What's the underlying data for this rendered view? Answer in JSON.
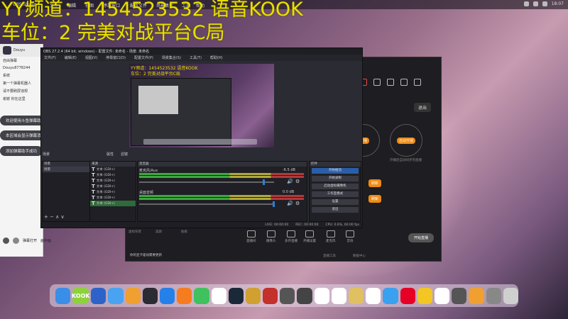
{
  "menubar": {
    "app": "OBS Studio",
    "items": [
      "文件",
      "编辑",
      "视图",
      "停靠窗口",
      "配置文件",
      "场景集合",
      "工具",
      "帮助"
    ],
    "time": "18:07"
  },
  "overlay": {
    "line1": "YY频道：1454523532 语音KOOK",
    "line2": "车位：2 完美对战平台C局"
  },
  "chat": {
    "room": "Douyu",
    "rows": [
      "自由弹幕",
      "Douyu8778244",
      "系统",
      "第一个弹幕机器人",
      "请不要刷屏违规",
      "谢谢 你在这里"
    ],
    "bubbles": [
      "欢迎使用斗鱼弹幕助手",
      "本区域会显示弹幕消息和礼物消息",
      "添加弹幕助手成功"
    ],
    "bottom": [
      "弹幕打开",
      "画中画"
    ]
  },
  "dark_app": {
    "exit_label": "退出",
    "circle_right": "自动开播",
    "circle_left": "开播",
    "caption": "开播后自动同步到直播",
    "orange1": "刷新",
    "orange2": "刷新",
    "controls": [
      "直播间",
      "摄像头",
      "多开直播",
      "开播设置",
      "麦克风",
      "音效"
    ],
    "notice": "你的显卡驱动需要更新",
    "left_tabs": [
      "虚拟背景",
      "美颜",
      "贴纸"
    ],
    "start_label": "开始直播",
    "footer": [
      "直播工具",
      "数据中心"
    ]
  },
  "obs": {
    "title": "OBS 27.2.4 (64 bit, windows) - 配置文件: 未命名 - 场景: 未命名",
    "menu": [
      "文件(F)",
      "编辑(E)",
      "视图(V)",
      "停靠窗口(D)",
      "配置文件(P)",
      "场景集合(S)",
      "工具(T)",
      "帮助(H)"
    ],
    "preview_text1": "YY频道：1454523532 语音KOOK",
    "preview_text2": "车位：2 完美对战平台C局",
    "scene_bar": [
      "场景",
      "属性",
      "滤镜"
    ],
    "panels": {
      "scenes_header": "场景",
      "scenes_item": "场景",
      "sources_header": "来源",
      "mixer_header": "混音器",
      "controls_header": "控件"
    },
    "sources": [
      {
        "name": "文本 (GDI+)",
        "selected": false
      },
      {
        "name": "文本 (GDI+)",
        "selected": false
      },
      {
        "name": "文本 (GDI+)",
        "selected": false
      },
      {
        "name": "文本 (GDI+)",
        "selected": false
      },
      {
        "name": "文本 (GDI+)",
        "selected": false
      },
      {
        "name": "文本 (GDI+)",
        "selected": false
      },
      {
        "name": "文本 (GDI+)",
        "selected": true
      }
    ],
    "mixer": [
      {
        "name": "麦克风/Aux",
        "db": "-6.5 dB"
      },
      {
        "name": "桌面音频",
        "db": "0.0 dB"
      }
    ],
    "controls": [
      "开始推流",
      "开始录制",
      "启动虚拟摄像机",
      "工作室模式",
      "设置",
      "退出"
    ],
    "transition": "转场",
    "status": [
      "LIVE: 00:00:00",
      "REC: 00:00:00",
      "CPU: 0.6%, 60.00 fps"
    ]
  },
  "dock": {
    "apps": [
      {
        "icon": "finder-icon",
        "label": "",
        "color": "#3b8ee8"
      },
      {
        "icon": "kook-icon",
        "label": "KOOK",
        "color": "#8dd13c"
      },
      {
        "icon": "rocket-icon",
        "label": "",
        "color": "#2d63c8"
      },
      {
        "icon": "safari-icon",
        "label": "",
        "color": "#4aa3f0"
      },
      {
        "icon": "orange-app-icon",
        "label": "",
        "color": "#f0a030"
      },
      {
        "icon": "obs-icon",
        "label": "",
        "color": "#2b2b33"
      },
      {
        "icon": "blue-app-icon",
        "label": "",
        "color": "#2680ea"
      },
      {
        "icon": "orange-app-icon",
        "label": "",
        "color": "#f57c1f"
      },
      {
        "icon": "wechat-icon",
        "label": "",
        "color": "#3fc25d"
      },
      {
        "icon": "qq-icon",
        "label": "",
        "color": "#ffffff"
      },
      {
        "icon": "steam-icon",
        "label": "",
        "color": "#1b2838"
      },
      {
        "icon": "game-icon",
        "label": "",
        "color": "#d0a030"
      },
      {
        "icon": "red-app-icon",
        "label": "",
        "color": "#c4302b"
      },
      {
        "icon": "ghost-icon",
        "label": "",
        "color": "#555555"
      },
      {
        "icon": "music-icon",
        "label": "",
        "color": "#444444"
      },
      {
        "icon": "dot-icon",
        "label": "",
        "color": "#ffffff"
      },
      {
        "icon": "dot-icon",
        "label": "",
        "color": "#ffffff"
      },
      {
        "icon": "folder-icon",
        "label": "",
        "color": "#e0c060"
      },
      {
        "icon": "dot-icon",
        "label": "",
        "color": "#ffffff"
      },
      {
        "icon": "cloud-icon",
        "label": "",
        "color": "#3aa0f0"
      },
      {
        "icon": "netease-icon",
        "label": "",
        "color": "#e60026"
      },
      {
        "icon": "owl-icon",
        "label": "",
        "color": "#f3c623"
      },
      {
        "icon": "dot-icon",
        "label": "",
        "color": "#ffffff"
      },
      {
        "icon": "ghost-icon",
        "label": "",
        "color": "#555555"
      },
      {
        "icon": "orange-app-icon",
        "label": "",
        "color": "#f0a030"
      },
      {
        "icon": "photo-icon",
        "label": "",
        "color": "#888888"
      },
      {
        "icon": "trash-icon",
        "label": "",
        "color": "#cfcfcf"
      }
    ]
  }
}
